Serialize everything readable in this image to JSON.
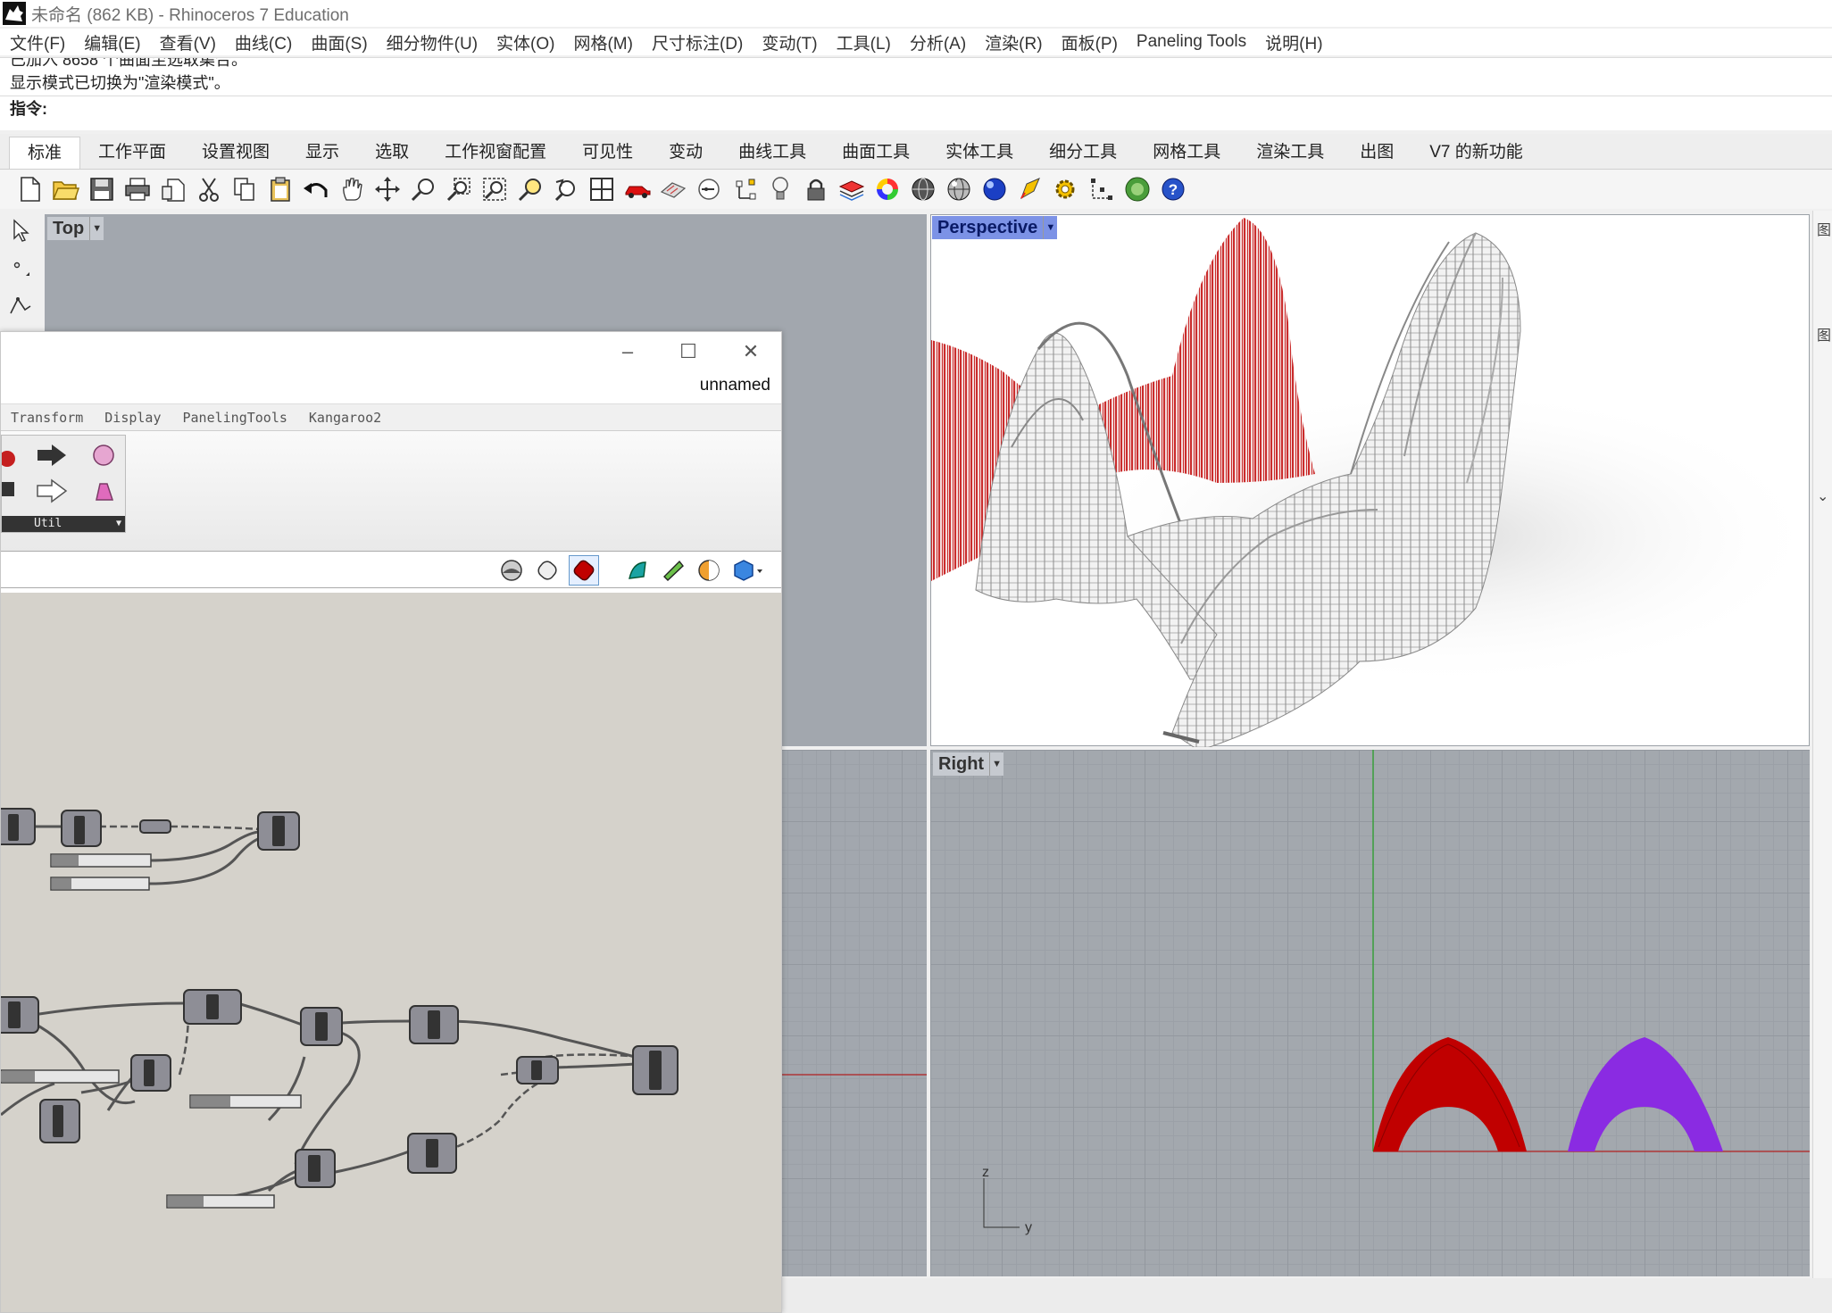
{
  "app": {
    "title": "未命名 (862 KB) - Rhinoceros 7 Education"
  },
  "menu": [
    "文件(F)",
    "编辑(E)",
    "查看(V)",
    "曲线(C)",
    "曲面(S)",
    "细分物件(U)",
    "实体(O)",
    "网格(M)",
    "尺寸标注(D)",
    "变动(T)",
    "工具(L)",
    "分析(A)",
    "渲染(R)",
    "面板(P)",
    "Paneling Tools",
    "说明(H)"
  ],
  "command": {
    "history": [
      "已加入 8658 个曲面至选取集合。",
      "显示模式已切换为\"渲染模式\"。"
    ],
    "prompt_label": "指令:"
  },
  "tabs": [
    "标准",
    "工作平面",
    "设置视图",
    "显示",
    "选取",
    "工作视窗配置",
    "可见性",
    "变动",
    "曲线工具",
    "曲面工具",
    "实体工具",
    "细分工具",
    "网格工具",
    "渲染工具",
    "出图",
    "V7 的新功能"
  ],
  "toolbar_icons": [
    "new-file-icon",
    "open-folder-icon",
    "save-icon",
    "print-icon",
    "import-icon",
    "cut-icon",
    "copy-icon",
    "paste-icon",
    "undo-icon",
    "pan-hand-icon",
    "rotate-view-icon",
    "zoom-icon",
    "zoom-window-icon",
    "zoom-extents-icon",
    "zoom-selected-icon",
    "undo-view-icon",
    "four-viewports-icon",
    "car-icon",
    "shade-icon",
    "osnap-icon",
    "gumball-icon",
    "light-bulb-icon",
    "lock-icon",
    "layer-icon",
    "color-wheel-icon",
    "sphere-wire-icon",
    "sphere-glass-icon",
    "sphere-blue-icon",
    "rocket-icon",
    "gear-icon",
    "points-icon",
    "render-globe-icon",
    "help-icon"
  ],
  "viewports": {
    "top": "Top",
    "perspective": "Perspective",
    "right": "Right",
    "axis_z": "z",
    "axis_y": "y"
  },
  "right_panel": [
    "图",
    "图"
  ],
  "grasshopper": {
    "document": "unnamed",
    "tabs": [
      "Transform",
      "Display",
      "PanelingTools",
      "Kangaroo2"
    ],
    "util_label": "Util"
  },
  "colors": {
    "red_mesh": "#c00000",
    "purple_mesh": "#8a2be2",
    "perspective_label": "#7c92e6",
    "viewport_bg": "#a2a7ae",
    "gh_canvas": "#d5d2cb"
  }
}
